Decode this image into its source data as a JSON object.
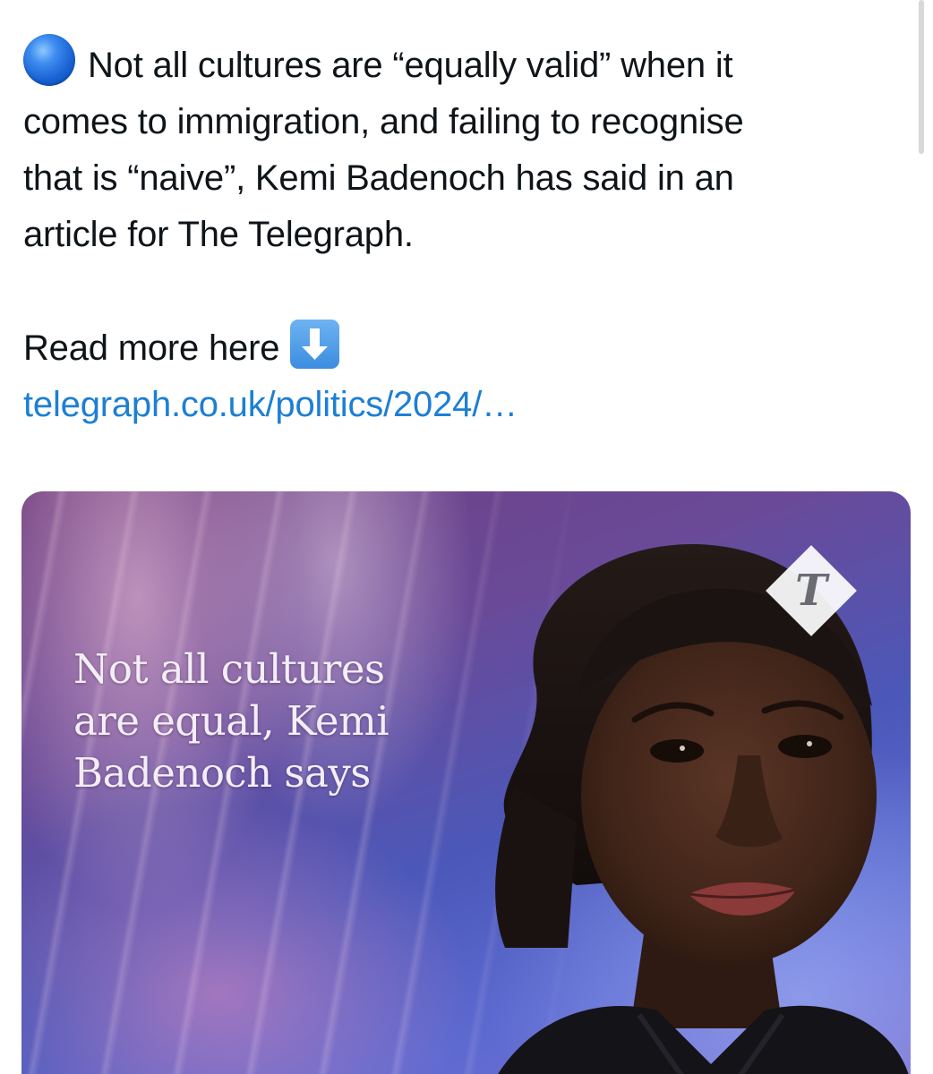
{
  "tweet": {
    "lines": [
      "Not all cultures are “equally valid” when it",
      "comes to immigration, and failing to recognise",
      "that is “naive”, Kemi Badenoch has said in an",
      "article for The Telegraph."
    ],
    "read_more": "Read more here",
    "link_text": "telegraph.co.uk/politics/2024/…"
  },
  "card": {
    "headline_lines": [
      "Not all cultures",
      "are equal, Kemi",
      "Badenoch says"
    ]
  },
  "icons": {
    "lead_emoji": "blue-circle-icon",
    "read_more_emoji": "down-arrow-icon",
    "publisher_logo": "telegraph-logo-icon"
  },
  "colors": {
    "link": "#1d7fd3",
    "text": "#0f1419",
    "emoji_blue": "#1862d4"
  }
}
